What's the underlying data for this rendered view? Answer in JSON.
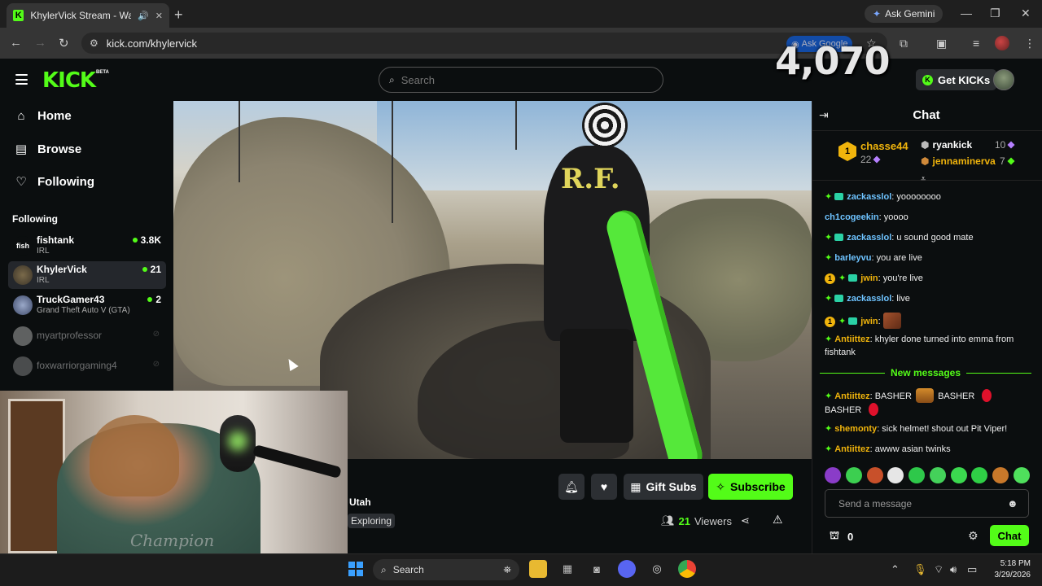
{
  "browser": {
    "tab_title": "KhylerVick Stream - Watch Live",
    "tab_favicon": "K",
    "new_tab": "+",
    "gemini_label": "Ask Gemini",
    "url": "kick.com/khylervick",
    "ask_google": "Ask Google"
  },
  "header": {
    "logo": "KICK",
    "logo_badge": "BETA",
    "search_placeholder": "Search",
    "viewer_overlay": "4,070",
    "get_kicks_label": "Get KICKs"
  },
  "sidebar": {
    "nav": [
      {
        "label": "Home",
        "icon": "home-icon"
      },
      {
        "label": "Browse",
        "icon": "browse-icon"
      },
      {
        "label": "Following",
        "icon": "heart-icon"
      }
    ],
    "following_title": "Following",
    "channels": [
      {
        "name": "fishtank",
        "category": "IRL",
        "viewers": "3.8K",
        "avatar": "fish",
        "live": true
      },
      {
        "name": "KhylerVick",
        "category": "IRL",
        "viewers": "21",
        "avatar": "",
        "live": true
      },
      {
        "name": "TruckGamer43",
        "category": "Grand Theft Auto V (GTA)",
        "viewers": "2",
        "avatar": "",
        "live": true
      },
      {
        "name": "myartprofessor",
        "category": "",
        "viewers": "",
        "avatar": "",
        "live": false
      },
      {
        "name": "foxwarriorgaming4",
        "category": "",
        "viewers": "",
        "avatar": "",
        "live": false
      }
    ]
  },
  "video": {
    "shirt_text": "R.F."
  },
  "stream": {
    "location": "Utah",
    "category": "Exploring",
    "gift_subs_label": "Gift Subs",
    "subscribe_label": "Subscribe",
    "viewer_count": "21",
    "viewers_label": "Viewers"
  },
  "webcam": {
    "shirt_text": "Champion"
  },
  "chat": {
    "title": "Chat",
    "leaderboard": {
      "first": {
        "rank": "1",
        "name": "chasse44",
        "points": "22"
      },
      "second": {
        "name": "ryankick",
        "points": "10"
      },
      "third": {
        "name": "jennaminerva",
        "points": "7"
      }
    },
    "messages": [
      {
        "user": "zackasslol",
        "color": "#6ec3ff",
        "text": ": yoooooooo",
        "badges": [
          "star",
          "sub"
        ]
      },
      {
        "user": "ch1cogeekin",
        "color": "#6ec3ff",
        "text": ": yoooo",
        "badges": []
      },
      {
        "user": "zackasslol",
        "color": "#6ec3ff",
        "text": ": u sound good mate",
        "badges": [
          "star",
          "sub"
        ]
      },
      {
        "user": "barleyvu",
        "color": "#6ec3ff",
        "text": ": you are live",
        "badges": [
          "star"
        ]
      },
      {
        "user": "jwin",
        "color": "#f0b40c",
        "text": ": you're live",
        "badges": [
          "one",
          "star",
          "sub"
        ]
      },
      {
        "user": "zackasslol",
        "color": "#6ec3ff",
        "text": ": live",
        "badges": [
          "star",
          "sub"
        ]
      },
      {
        "user": "jwin",
        "color": "#f0b40c",
        "text": ":",
        "badges": [
          "one",
          "star",
          "sub"
        ],
        "emote": true
      },
      {
        "user": "Antiittez",
        "color": "#f0b40c",
        "text": ": khyler done turned into emma from fishtank",
        "badges": [
          "star"
        ]
      }
    ],
    "new_messages_label": "New messages",
    "new_messages": [
      {
        "user": "Antiittez",
        "color": "#f0b40c",
        "parts": [
          ": BASHER ",
          " BASHER ",
          " BASHER "
        ]
      },
      {
        "user": "shemonty",
        "color": "#f0b40c",
        "text": ": sick helmet! shout out Pit Viper!"
      },
      {
        "user": "Antiittez",
        "color": "#f0b40c",
        "text": ": awww asian twinks"
      }
    ],
    "input_placeholder": "Send a message",
    "points": "0",
    "send_label": "Chat"
  },
  "taskbar": {
    "search_label": "Search",
    "time": "5:18 PM",
    "date": "3/29/2026"
  },
  "colors": {
    "kick_green": "#53fc18",
    "background": "#0b0e0f",
    "gold": "#f0b40c"
  }
}
